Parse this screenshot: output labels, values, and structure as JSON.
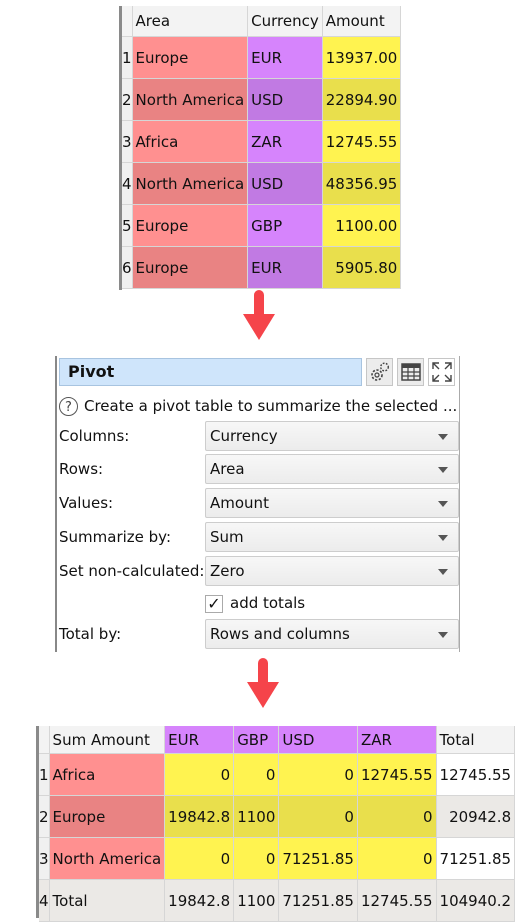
{
  "source_table": {
    "headers": [
      "Area",
      "Currency",
      "Amount"
    ],
    "rows": [
      {
        "index": "1",
        "area": "Europe",
        "currency": "EUR",
        "amount": "13937.00"
      },
      {
        "index": "2",
        "area": "North America",
        "currency": "USD",
        "amount": "22894.90"
      },
      {
        "index": "3",
        "area": "Africa",
        "currency": "ZAR",
        "amount": "12745.55"
      },
      {
        "index": "4",
        "area": "North America",
        "currency": "USD",
        "amount": "48356.95"
      },
      {
        "index": "5",
        "area": "Europe",
        "currency": "GBP",
        "amount": "1100.00"
      },
      {
        "index": "6",
        "area": "Europe",
        "currency": "EUR",
        "amount": "5905.80"
      }
    ]
  },
  "colors": {
    "area": "#ff9090",
    "currency": "#d684fc",
    "amount": "#fff350",
    "arrow": "#f5444a",
    "title_bar": "#cfe5fb"
  },
  "pivot_panel": {
    "title": "Pivot",
    "icons": [
      "gears-icon",
      "table-icon",
      "expand-icon"
    ],
    "help_text": "Create a pivot table to summarize the selected ...",
    "fields": [
      {
        "label": "Columns:",
        "value": "Currency"
      },
      {
        "label": "Rows:",
        "value": "Area"
      },
      {
        "label": "Values:",
        "value": "Amount"
      },
      {
        "label": "Summarize by:",
        "value": "Sum"
      },
      {
        "label": "Set non-calculated:",
        "value": "Zero"
      }
    ],
    "add_totals": {
      "label": "add totals",
      "checked": true,
      "mark": "✓"
    },
    "total_by": {
      "label": "Total by:",
      "value": "Rows and columns"
    }
  },
  "result_table": {
    "headers": [
      "Sum Amount",
      "EUR",
      "GBP",
      "USD",
      "ZAR",
      "Total"
    ],
    "rows": [
      {
        "index": "1",
        "area": "Africa",
        "eur": "0",
        "gbp": "0",
        "usd": "0",
        "zar": "12745.55",
        "total": "12745.55"
      },
      {
        "index": "2",
        "area": "Europe",
        "eur": "19842.8",
        "gbp": "1100",
        "usd": "0",
        "zar": "0",
        "total": "20942.8"
      },
      {
        "index": "3",
        "area": "North America",
        "eur": "0",
        "gbp": "0",
        "usd": "71251.85",
        "zar": "0",
        "total": "71251.85"
      },
      {
        "index": "4",
        "area": "Total",
        "eur": "19842.8",
        "gbp": "1100",
        "usd": "71251.85",
        "zar": "12745.55",
        "total": "104940.2"
      }
    ]
  }
}
